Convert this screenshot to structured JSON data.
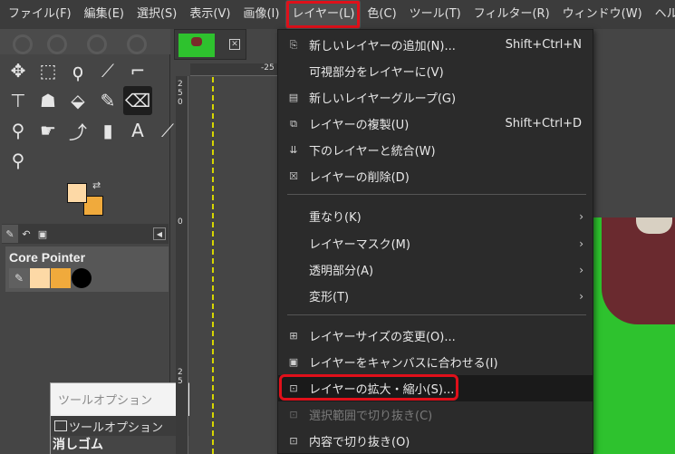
{
  "menubar": {
    "items": [
      "ファイル(F)",
      "編集(E)",
      "選択(S)",
      "表示(V)",
      "画像(I)",
      "レイヤー(L)",
      "色(C)",
      "ツール(T)",
      "フィルター(R)",
      "ウィンドウ(W)",
      "ヘルプ(H)"
    ],
    "open_index": 5
  },
  "toolbox": {
    "tools": [
      "move",
      "rect-select",
      "free-select",
      "fuzzy-select",
      "crop",
      "",
      "text",
      "bucket",
      "paint",
      "brush",
      "eraser",
      "",
      "clone",
      "smudge",
      "path",
      "ink",
      "text-tool",
      "color-picker",
      "zoom"
    ],
    "colors": {
      "foreground": "#fdd9a6",
      "background": "#f0aa3c"
    },
    "brushes_panel": {
      "title": "Core Pointer"
    }
  },
  "tool_options_window": {
    "title": "ツールオプション",
    "tab_label": "ツールオプション",
    "tool_name": "消しゴム"
  },
  "canvas": {
    "ruler_top_label": "-25",
    "ruler_left_labels": [
      "2",
      "5",
      "0",
      "0",
      "2",
      "5"
    ]
  },
  "layer_menu": {
    "items": [
      {
        "label": "新しいレイヤーの追加(N)...",
        "shortcut": "Shift+Ctrl+N",
        "icon": "new-layer-icon"
      },
      {
        "label": "可視部分をレイヤーに(V)",
        "shortcut": "",
        "icon": ""
      },
      {
        "label": "新しいレイヤーグループ(G)",
        "shortcut": "",
        "icon": "new-group-icon"
      },
      {
        "label": "レイヤーの複製(U)",
        "shortcut": "Shift+Ctrl+D",
        "icon": "duplicate-icon"
      },
      {
        "label": "下のレイヤーと統合(W)",
        "shortcut": "",
        "icon": "merge-down-icon"
      },
      {
        "label": "レイヤーの削除(D)",
        "shortcut": "",
        "icon": "delete-icon"
      },
      {
        "label": "重なり(K)",
        "submenu": true
      },
      {
        "label": "レイヤーマスク(M)",
        "submenu": true
      },
      {
        "label": "透明部分(A)",
        "submenu": true
      },
      {
        "label": "変形(T)",
        "submenu": true
      },
      {
        "label": "レイヤーサイズの変更(O)...",
        "icon": "layer-size-icon"
      },
      {
        "label": "レイヤーをキャンバスに合わせる(I)",
        "icon": "fit-canvas-icon"
      },
      {
        "label": "レイヤーの拡大・縮小(S)...",
        "icon": "scale-layer-icon",
        "highlighted": true
      },
      {
        "label": "選択範囲で切り抜き(C)",
        "icon": "crop-selection-icon",
        "disabled": true
      },
      {
        "label": "内容で切り抜き(O)",
        "icon": "crop-content-icon"
      }
    ]
  }
}
